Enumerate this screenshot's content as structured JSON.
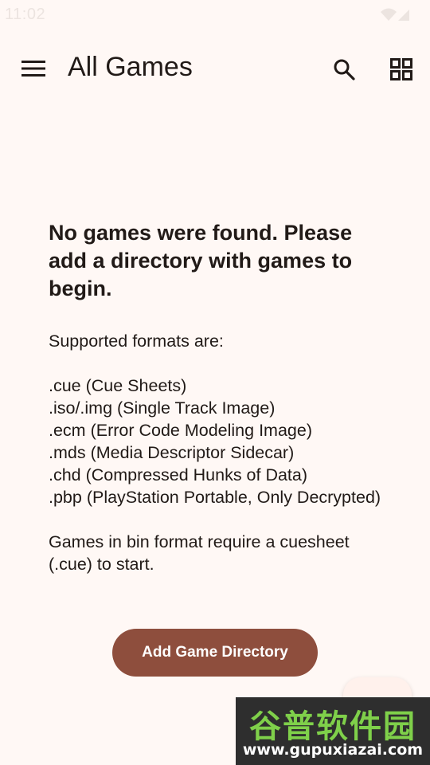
{
  "status_bar": {
    "time": "11:02",
    "icons": [
      "wifi-icon",
      "cellular-signal-icon"
    ]
  },
  "app_bar": {
    "title": "All Games",
    "menu_icon": "menu-icon",
    "search_icon": "search-icon",
    "grid_icon": "grid-view-icon"
  },
  "empty_state": {
    "heading": "No games were found. Please add a directory with games to begin.",
    "body": "Supported formats are:\n\n.cue (Cue Sheets)\n.iso/.img (Single Track Image)\n.ecm (Error Code Modeling Image)\n.mds (Media Descriptor Sidecar)\n.chd (Compressed Hunks of Data)\n.pbp (PlayStation Portable, Only Decrypted)\n\nGames in bin format require a cuesheet (.cue) to start."
  },
  "actions": {
    "add_directory_label": "Add Game Directory",
    "fab_icon": "folder-icon"
  },
  "watermark": {
    "title": "谷普软件园",
    "url": "www.gupuxiazai.com"
  },
  "colors": {
    "background": "#FFF8F5",
    "primary": "#8E4E3D",
    "on_surface": "#211A17"
  }
}
